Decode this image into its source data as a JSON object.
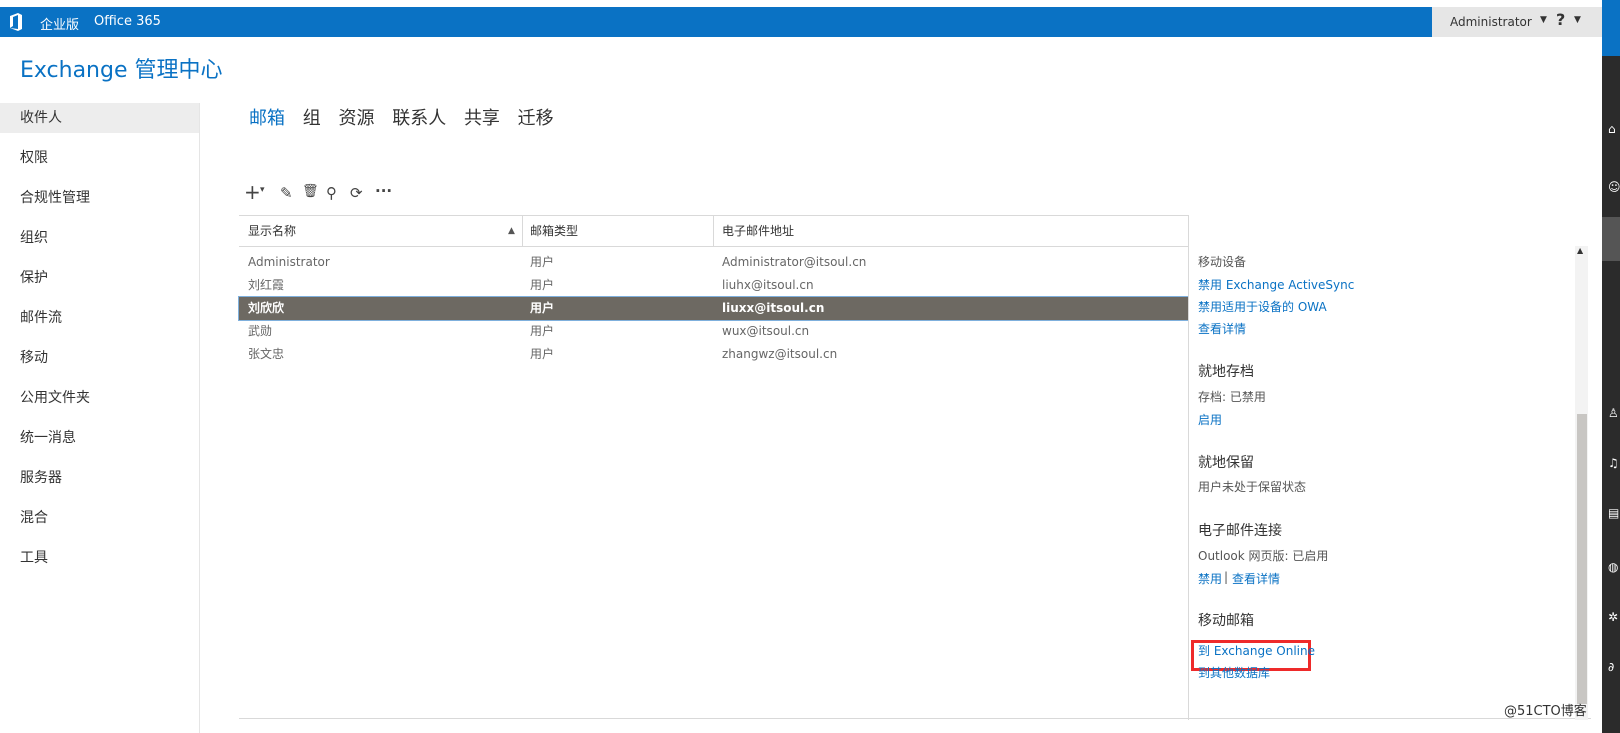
{
  "header": {
    "edition": "企业版",
    "office": "Office 365",
    "user": "Administrator",
    "help": "?"
  },
  "app_title": "Exchange 管理中心",
  "sidebar": {
    "items": [
      {
        "label": "收件人",
        "active": true
      },
      {
        "label": "权限"
      },
      {
        "label": "合规性管理"
      },
      {
        "label": "组织"
      },
      {
        "label": "保护"
      },
      {
        "label": "邮件流"
      },
      {
        "label": "移动"
      },
      {
        "label": "公用文件夹"
      },
      {
        "label": "统一消息"
      },
      {
        "label": "服务器"
      },
      {
        "label": "混合"
      },
      {
        "label": "工具"
      }
    ]
  },
  "tabs": [
    {
      "label": "邮箱",
      "active": true
    },
    {
      "label": "组"
    },
    {
      "label": "资源"
    },
    {
      "label": "联系人"
    },
    {
      "label": "共享"
    },
    {
      "label": "迁移"
    }
  ],
  "toolbar": {
    "add": "+",
    "add_caret": "▾",
    "edit": "✎",
    "delete": "🗑",
    "search": "⚲",
    "refresh": "⟳",
    "more": "···"
  },
  "table": {
    "columns": [
      "显示名称",
      "邮箱类型",
      "电子邮件地址"
    ],
    "sort_indicator": "▲",
    "rows": [
      {
        "name": "Administrator",
        "type": "用户",
        "email": "Administrator@itsoul.cn"
      },
      {
        "name": "刘红霞",
        "type": "用户",
        "email": "liuhx@itsoul.cn"
      },
      {
        "name": "刘欣欣",
        "type": "用户",
        "email": "liuxx@itsoul.cn",
        "selected": true
      },
      {
        "name": "武勋",
        "type": "用户",
        "email": "wux@itsoul.cn"
      },
      {
        "name": "张文忠",
        "type": "用户",
        "email": "zhangwz@itsoul.cn"
      }
    ]
  },
  "details": {
    "mobile_devices": "移动设备",
    "disable_activesync": "禁用 Exchange ActiveSync",
    "disable_owa_devices": "禁用适用于设备的 OWA",
    "view_details_1": "查看详情",
    "archive_heading": "就地存档",
    "archive_status": "存档: 已禁用",
    "enable": "启用",
    "hold_heading": "就地保留",
    "hold_status": "用户未处于保留状态",
    "email_conn_heading": "电子邮件连接",
    "owa_status": "Outlook 网页版: 已启用",
    "disable": "禁用",
    "link_sep": "|",
    "view_details_2": "查看详情",
    "move_heading": "移动邮箱",
    "to_exchange_online": "到 Exchange Online",
    "to_other_db": "到其他数据库"
  },
  "watermark": "@51CTO博客",
  "colors": {
    "accent": "#0a72c4",
    "selected_row": "#6d6962",
    "highlight": "#ee2a2a"
  }
}
